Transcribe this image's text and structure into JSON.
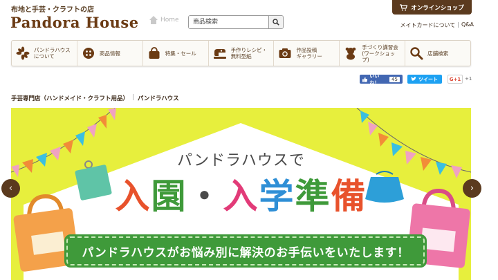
{
  "header": {
    "tagline": "布地と手芸・クラフトの店",
    "logo": "Pandora House",
    "home_label": "Home",
    "search": {
      "placeholder": "商品検索",
      "value": ""
    },
    "shop_button": "オンラインショップ",
    "links": [
      "メイトカードについて",
      "Q&A"
    ],
    "links_sep": "|"
  },
  "nav": {
    "items": [
      {
        "label_l1": "パンドラハウス",
        "label_l2": "について",
        "icon": "flower-icon"
      },
      {
        "label_l1": "商品情報",
        "label_l2": "",
        "icon": "button-icon"
      },
      {
        "label_l1": "特集・セール",
        "label_l2": "",
        "icon": "bag-icon"
      },
      {
        "label_l1": "手作りレシピ・",
        "label_l2": "無料型紙",
        "icon": "sewing-machine-icon"
      },
      {
        "label_l1": "作品投稿",
        "label_l2": "ギャラリー",
        "icon": "camera-icon"
      },
      {
        "label_l1": "手づくり講習会",
        "label_l2": "(ワークショップ)",
        "icon": "bear-icon"
      },
      {
        "label_l1": "店舗検索",
        "label_l2": "",
        "icon": "search-icon"
      }
    ]
  },
  "social": {
    "like_label": "いいね！",
    "like_count": "45",
    "tweet_label": "ツイート",
    "gplus_label": "G+1",
    "gplus_count": "+1"
  },
  "breadcrumb": {
    "page": "手芸専門店（ハンドメイド・クラフト用品）",
    "sep": "|",
    "site": "パンドラハウス"
  },
  "banner": {
    "subtitle": "パンドラハウスで",
    "title_parts": [
      "入",
      "園",
      "・",
      "入",
      "学",
      "準",
      "備"
    ],
    "catch": "パンドラハウスがお悩み別に解決のお手伝いをいたします！",
    "title_colors": [
      "#e8522c",
      "#3f9a3a",
      "#4a4a4a",
      "#e23b78",
      "#2f8fd6",
      "#3f9a3a",
      "#e8522c"
    ],
    "background": "#e7ef3d"
  },
  "carousel": {
    "prev": "‹",
    "next": "›"
  },
  "colors": {
    "brand_brown": "#5b3a1e",
    "logo_brown": "#6b3b14"
  }
}
